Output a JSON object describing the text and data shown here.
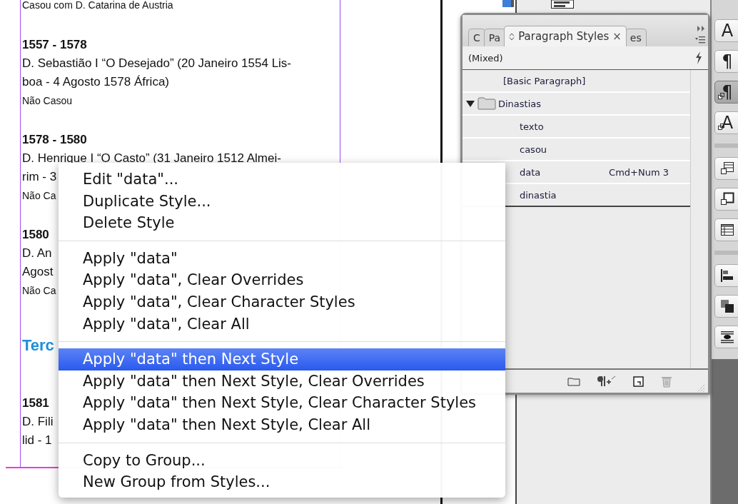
{
  "document": {
    "top_line": "Casou com D. Catarina de Austria",
    "blocks": [
      {
        "kind": "entry",
        "years": "1557 - 1578",
        "lines": [
          "D. Sebastião I “O Desejado” (20 Janeiro 1554 Lis-",
          "boa - 4 Agosto 1578 África)"
        ],
        "married": "Não Casou"
      },
      {
        "kind": "entry",
        "years": "1578 - 1580",
        "lines": [
          "D. Henrique I “O Casto” (31 Janeiro 1512 Almei-",
          "rim - 3"
        ],
        "married": "Não Ca"
      },
      {
        "kind": "entry",
        "years": "1580",
        "lines": [
          "D. An",
          "Agost"
        ],
        "married": "Não Ca"
      },
      {
        "kind": "heading",
        "text": "Terc"
      },
      {
        "kind": "entry",
        "years": "1581",
        "lines": [
          "D. Fili",
          "lid - 1"
        ]
      }
    ]
  },
  "panel": {
    "tabs": [
      {
        "label": "C",
        "selected": false
      },
      {
        "label": "Pa",
        "selected": false
      },
      {
        "label": "Paragraph Styles",
        "selected": true,
        "close": "×"
      },
      {
        "label": "es",
        "selected": false
      }
    ],
    "current": "(Mixed)",
    "styles": [
      {
        "kind": "style",
        "name": "[Basic Paragraph]"
      },
      {
        "kind": "group",
        "name": "Dinastias",
        "expanded": true,
        "children": [
          {
            "kind": "style",
            "name": "texto"
          },
          {
            "kind": "style",
            "name": "casou"
          },
          {
            "kind": "style",
            "name": "data",
            "shortcut": "Cmd+Num 3"
          },
          {
            "kind": "style",
            "name": "dinastia"
          }
        ]
      }
    ]
  },
  "toolbar": [
    {
      "kind": "char",
      "text": "A"
    },
    {
      "kind": "char",
      "text": "¶"
    },
    {
      "kind": "linked",
      "text": "¶",
      "selected": true
    },
    {
      "kind": "linked",
      "text": "A"
    },
    {
      "kind": "cellstyle"
    },
    {
      "kind": "objectstyle"
    },
    {
      "kind": "table"
    },
    {
      "kind": "align"
    },
    {
      "kind": "stack"
    },
    {
      "kind": "wrap"
    }
  ],
  "context_menu": {
    "groups": [
      {
        "items": [
          {
            "label": "Edit \"data\"...",
            "selected": false
          },
          {
            "label": "Duplicate Style...",
            "selected": false
          },
          {
            "label": "Delete Style",
            "selected": false
          }
        ]
      },
      {
        "items": [
          {
            "label": "Apply \"data\"",
            "selected": false
          },
          {
            "label": "Apply \"data\", Clear Overrides",
            "selected": false
          },
          {
            "label": "Apply \"data\", Clear Character Styles",
            "selected": false
          },
          {
            "label": "Apply \"data\", Clear All",
            "selected": false
          }
        ]
      },
      {
        "items": [
          {
            "label": "Apply \"data\" then Next Style",
            "selected": true
          },
          {
            "label": "Apply \"data\" then Next Style, Clear Overrides",
            "selected": false
          },
          {
            "label": "Apply \"data\" then Next Style, Clear Character Styles",
            "selected": false
          },
          {
            "label": "Apply \"data\" then Next Style, Clear All",
            "selected": false
          }
        ]
      },
      {
        "items": [
          {
            "label": "Copy to Group...",
            "selected": false
          },
          {
            "label": "New Group from Styles...",
            "selected": false
          }
        ]
      }
    ]
  }
}
